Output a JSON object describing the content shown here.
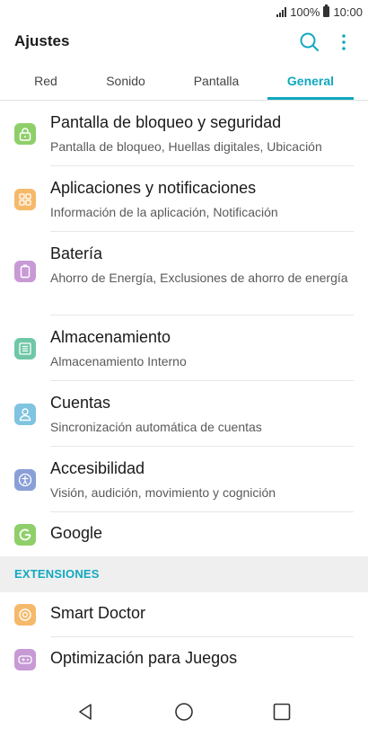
{
  "status_bar": {
    "battery": "100%",
    "time": "10:00"
  },
  "app_bar": {
    "title": "Ajustes",
    "search_icon": "search-icon",
    "more_icon": "more-vert-icon"
  },
  "tabs": [
    {
      "label": "Red",
      "active": false
    },
    {
      "label": "Sonido",
      "active": false
    },
    {
      "label": "Pantalla",
      "active": false
    },
    {
      "label": "General",
      "active": true
    }
  ],
  "items": [
    {
      "title": "Pantalla de bloqueo y seguridad",
      "subtitle": "Pantalla de bloqueo, Huellas digitales, Ubicación",
      "icon": "lock-icon",
      "color": "#8fcf6a"
    },
    {
      "title": "Aplicaciones y notificaciones",
      "subtitle": "Información de la aplicación, Notificación",
      "icon": "apps-grid-icon",
      "color": "#f5b96a"
    },
    {
      "title": "Batería",
      "subtitle": "Ahorro de Energía, Exclusiones de ahorro de energía",
      "icon": "battery-icon",
      "color": "#c79ad6"
    },
    {
      "title": "Almacenamiento",
      "subtitle": "Almacenamiento Interno",
      "icon": "storage-icon",
      "color": "#6fc7a8"
    },
    {
      "title": "Cuentas",
      "subtitle": "Sincronización automática de cuentas",
      "icon": "account-icon",
      "color": "#7fc4e0"
    },
    {
      "title": "Accesibilidad",
      "subtitle": "Visión, audición, movimiento y cognición",
      "icon": "accessibility-icon",
      "color": "#8a9fd8"
    },
    {
      "title": "Google",
      "subtitle": "",
      "icon": "google-icon",
      "color": "#8fcf6a"
    }
  ],
  "section": {
    "label": "EXTENSIONES"
  },
  "extensions": [
    {
      "title": "Smart Doctor",
      "icon": "smart-doctor-icon",
      "color": "#f5b96a"
    },
    {
      "title": "Optimización para Juegos",
      "icon": "gamepad-icon",
      "color": "#c79ad6"
    }
  ],
  "nav": {
    "back": "back-icon",
    "home": "home-icon",
    "recents": "recents-icon"
  },
  "colors": {
    "accent": "#10a8c0"
  }
}
